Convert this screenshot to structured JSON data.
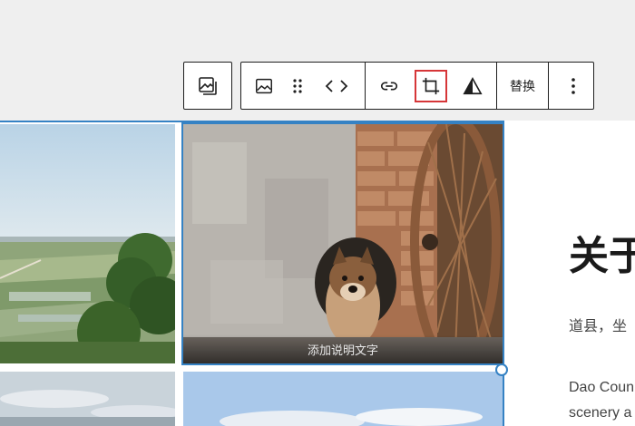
{
  "toolbar": {
    "image_type_icon": "image-block-icon",
    "buttons": [
      {
        "icon": "image-icon"
      },
      {
        "icon": "drag-handle-icon"
      },
      {
        "icon": "move-arrows-icon"
      },
      {
        "icon": "link-icon"
      },
      {
        "icon": "crop-icon",
        "active": true
      },
      {
        "icon": "filter-triangle-icon"
      }
    ],
    "replace_label": "替换",
    "more_icon": "more-vertical-icon",
    "active_color": "#d63638"
  },
  "gallery": {
    "dog_image_caption": "添加说明文字",
    "selection_color": "#3582c4"
  },
  "content": {
    "heading": "关于",
    "paragraph_cn": "道县，坐",
    "paragraph_en_line1": "Dao Coun",
    "paragraph_en_line2": "scenery a"
  }
}
